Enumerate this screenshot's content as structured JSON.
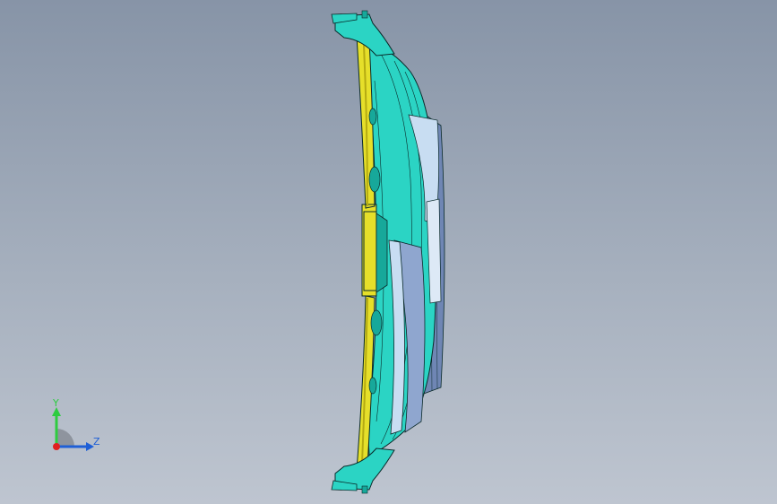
{
  "viewport": {
    "background_top": "#8794a7",
    "background_bottom": "#bec5d0"
  },
  "model": {
    "part": "bumper-side-view",
    "colors": {
      "body": "#2bd4c4",
      "body_dark": "#17a89a",
      "flange": "#e6df2a",
      "flange_dark": "#b5ab12",
      "panel_light": "#c8ddf2",
      "panel_mid": "#8fa6cf",
      "panel_dark": "#6f86b4",
      "edge": "#0a2a2a"
    }
  },
  "triad": {
    "y_label": "Y",
    "z_label": "Z",
    "y_color": "#2ecc40",
    "z_color": "#1f5fd6",
    "origin_color": "#e02020"
  }
}
